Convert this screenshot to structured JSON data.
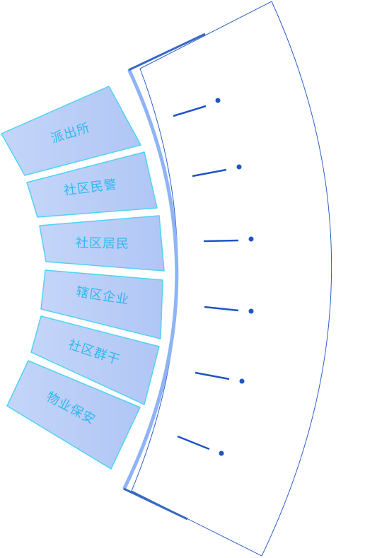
{
  "tabs": [
    {
      "id": "police-station",
      "label": "派出所"
    },
    {
      "id": "community-police",
      "label": "社区民警"
    },
    {
      "id": "community-residents",
      "label": "社区居民"
    },
    {
      "id": "district-enterprises",
      "label": "辖区企业"
    },
    {
      "id": "community-cadres",
      "label": "社区群干"
    },
    {
      "id": "property-security",
      "label": "物业保安"
    }
  ],
  "colors": {
    "tab_fill": "#b7cbf6",
    "tab_edge": "#4fd3f4",
    "arc_light": "#8fb4f5",
    "arc_dark": "#3768c2",
    "fan_stroke": "#2e5fc9",
    "pointer": "#1d55c4",
    "label": "#2fb8f0"
  }
}
